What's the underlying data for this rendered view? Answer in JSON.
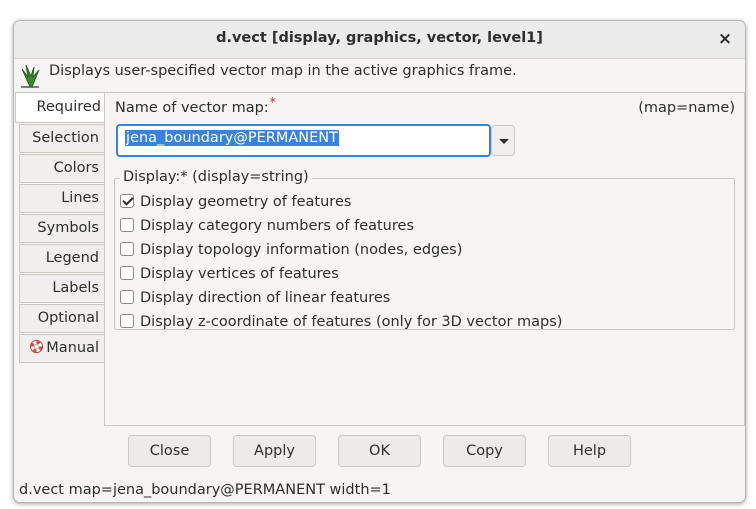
{
  "window": {
    "title": "d.vect [display, graphics, vector, level1]",
    "close_symbol": "×",
    "description": "Displays user-specified vector map in the active graphics frame.",
    "icon": "grass-logo-icon"
  },
  "tabs": [
    {
      "label": "Required",
      "active": true
    },
    {
      "label": "Selection",
      "active": false
    },
    {
      "label": "Colors",
      "active": false
    },
    {
      "label": "Lines",
      "active": false
    },
    {
      "label": "Symbols",
      "active": false
    },
    {
      "label": "Legend",
      "active": false
    },
    {
      "label": "Labels",
      "active": false
    },
    {
      "label": "Optional",
      "active": false
    },
    {
      "label": "Manual",
      "active": false,
      "icon": "lifebuoy-icon"
    }
  ],
  "map_field": {
    "label": "Name of vector map:",
    "required_mark": "*",
    "key": "(map=name)",
    "value": "jena_boundary@PERMANENT"
  },
  "display_group": {
    "legend": "Display:*  (display=string)",
    "options": [
      {
        "label": "Display geometry of features",
        "checked": true
      },
      {
        "label": "Display category numbers of features",
        "checked": false
      },
      {
        "label": "Display topology information (nodes, edges)",
        "checked": false
      },
      {
        "label": "Display vertices of features",
        "checked": false
      },
      {
        "label": "Display direction of linear features",
        "checked": false
      },
      {
        "label": "Display z-coordinate of features (only for 3D vector maps)",
        "checked": false
      }
    ]
  },
  "buttons": {
    "close": "Close",
    "apply": "Apply",
    "ok": "OK",
    "copy": "Copy",
    "help": "Help"
  },
  "statusbar": "d.vect map=jena_boundary@PERMANENT width=1",
  "colors": {
    "accent": "#3584e4",
    "required": "#e01b24"
  }
}
